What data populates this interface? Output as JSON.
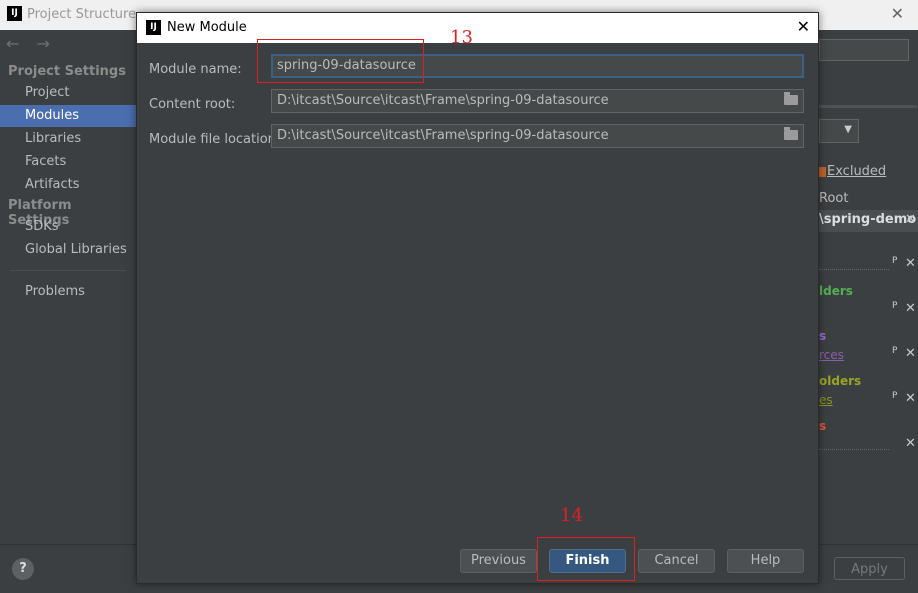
{
  "background_window": {
    "title": "Project Structure",
    "logo_text": "IJ",
    "nav_arrows": "← →",
    "sidebar": {
      "project_settings_header": "Project Settings",
      "project_settings_items": [
        "Project",
        "Modules",
        "Libraries",
        "Facets",
        "Artifacts"
      ],
      "platform_settings_header": "Platform Settings",
      "platform_settings_items": [
        "SDKs",
        "Global Libraries"
      ],
      "problems": "Problems"
    },
    "right_panel": {
      "excluded_label": "Excluded",
      "root_label": "Root",
      "path_fragment": "\\spring-demo",
      "frag_folders1": "lders",
      "frag_s1": "s",
      "frag_rces": "rces",
      "frag_folders2": "olders",
      "frag_es": "es",
      "frag_s2": "s"
    },
    "help_label": "?",
    "apply_label": "Apply"
  },
  "dialog": {
    "title": "New Module",
    "logo_text": "IJ",
    "module_name_label": "Module name:",
    "module_name_value": "spring-09-datasource",
    "content_root_label": "Content root:",
    "content_root_value": "D:\\itcast\\Source\\itcast\\Frame\\spring-09-datasource",
    "module_file_location_label": "Module file location:",
    "module_file_location_value": "D:\\itcast\\Source\\itcast\\Frame\\spring-09-datasource",
    "buttons": {
      "previous": "Previous",
      "finish": "Finish",
      "cancel": "Cancel",
      "help": "Help"
    }
  },
  "annotations": {
    "step13": "13",
    "step14": "14"
  },
  "colors": {
    "selection": "#4b6eaf",
    "primary_button": "#365880",
    "annotation": "#e02020"
  }
}
